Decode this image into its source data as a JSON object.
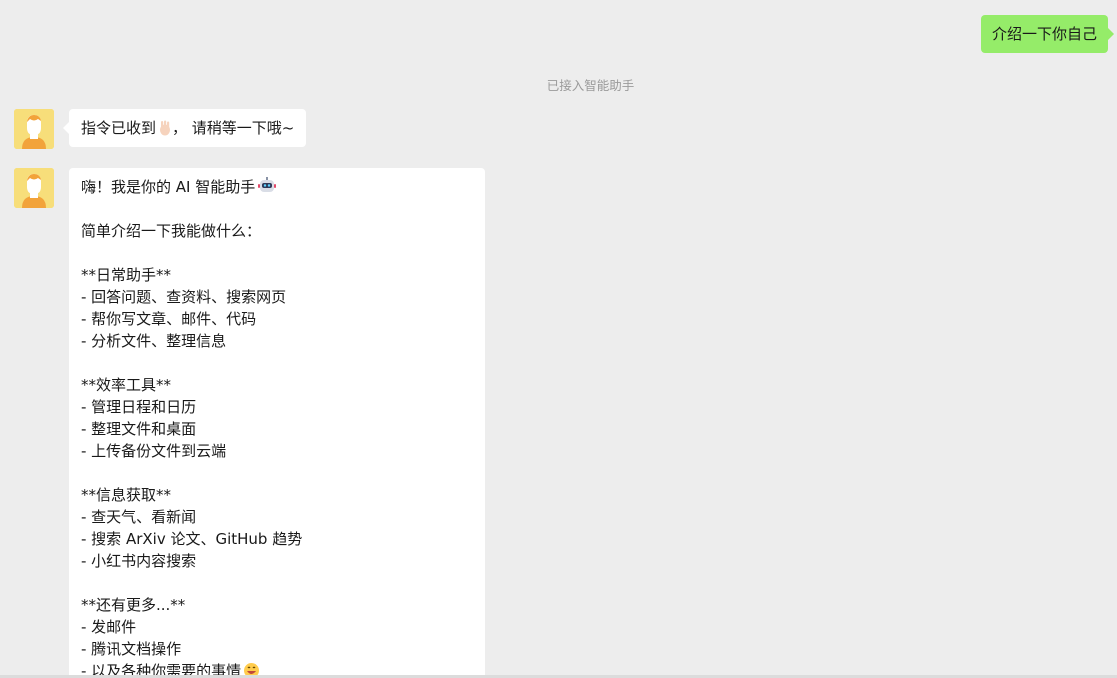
{
  "conversation": {
    "outgoing": {
      "text": "介绍一下你自己"
    },
    "system_notice": "已接入智能助手",
    "replies": [
      {
        "avatar_icon": "user-avatar-icon",
        "text": "指令已收到",
        "suffix": "，  请稍等一下哦~",
        "emoji": "ok-hand-emoji"
      },
      {
        "avatar_icon": "user-avatar-icon",
        "lines": [
          "嗨！我是你的 AI 智能助手",
          "",
          "简单介绍一下我能做什么：",
          "",
          "**日常助手**",
          "- 回答问题、查资料、搜索网页",
          "- 帮你写文章、邮件、代码",
          "- 分析文件、整理信息",
          "",
          "**效率工具**",
          "- 管理日程和日历",
          "- 整理文件和桌面",
          "- 上传备份文件到云端",
          "",
          "**信息获取**",
          "- 查天气、看新闻",
          "- 搜索 ArXiv 论文、GitHub 趋势",
          "- 小红书内容搜索",
          "",
          "**还有更多...**",
          "- 发邮件",
          "- 腾讯文档操作",
          "- 以及各种你需要的事情"
        ],
        "emojis": [
          "robot-emoji",
          "grinning-emoji"
        ]
      }
    ]
  },
  "colors": {
    "background": "#ededed",
    "outgoing_bubble": "#95ec69",
    "incoming_bubble": "#ffffff",
    "notice_text": "#9a9a9a",
    "avatar_bg": "#f7de7a"
  }
}
